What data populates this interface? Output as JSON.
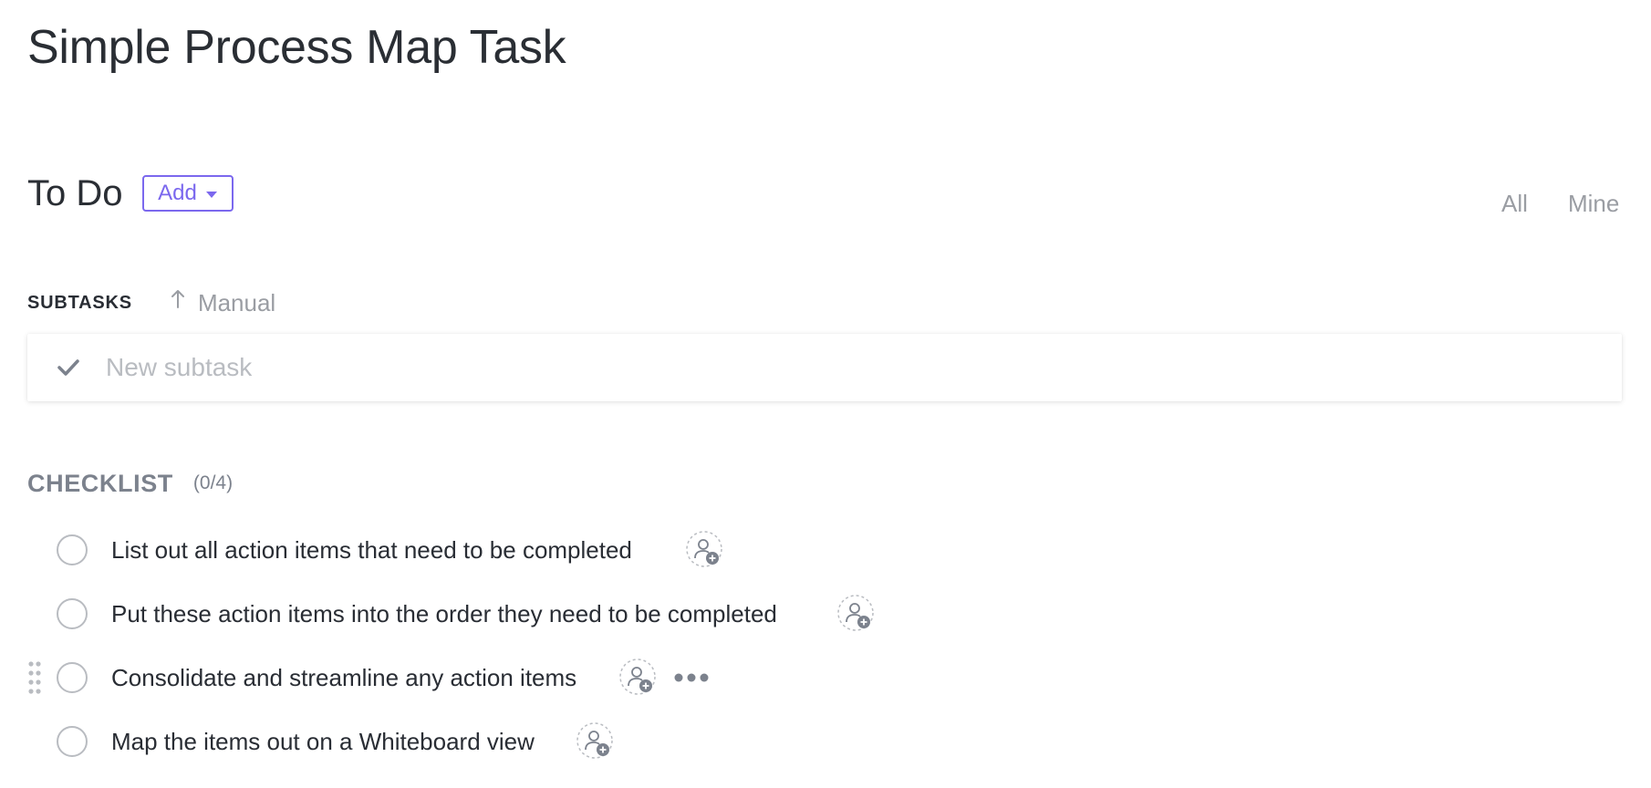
{
  "task": {
    "title": "Simple Process Map Task"
  },
  "status": {
    "label": "To Do",
    "add_label": "Add"
  },
  "filters": {
    "all": "All",
    "mine": "Mine"
  },
  "subtasks": {
    "label": "SUBTASKS",
    "sort_label": "Manual",
    "new_placeholder": "New subtask"
  },
  "checklist": {
    "title": "CHECKLIST",
    "count": "(0/4)",
    "items": [
      {
        "text": "List out all action items that need to be completed",
        "checked": false
      },
      {
        "text": "Put these action items into the order they need to be completed",
        "checked": false
      },
      {
        "text": "Consolidate and streamline any action items",
        "checked": false
      },
      {
        "text": "Map the items out on a Whiteboard view",
        "checked": false
      }
    ]
  },
  "colors": {
    "accent": "#7b68ee",
    "text": "#292d34",
    "muted": "#9a9da3"
  },
  "icons": {
    "status_caret": "chevron-down-icon",
    "sort": "arrow-up-icon",
    "new_subtask": "check-icon",
    "assign": "assign-user-icon",
    "more": "more-icon",
    "drag": "drag-handle-icon"
  }
}
